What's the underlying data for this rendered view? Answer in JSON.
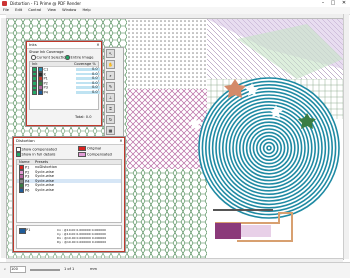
{
  "window": {
    "title": "Distortion - F1 Prime @ PDF Render",
    "minimize": "–",
    "maximize": "□",
    "close": "✕"
  },
  "menu": [
    "File",
    "Edit",
    "Control",
    "View",
    "Window",
    "Help"
  ],
  "ink_panel": {
    "title": "Inks",
    "section_label": "Show Ink Coverage",
    "option_current": "Current Selection",
    "option_entire": "Entire Image",
    "columns": [
      "Ink",
      "Coverage %"
    ],
    "rows": [
      {
        "name": "C1",
        "color": "#2c8fb0",
        "value": "0.0"
      },
      {
        "name": "K",
        "color": "#2b2b2b",
        "value": "0.0"
      },
      {
        "name": "P1",
        "color": "#c0392b",
        "value": "0.0"
      },
      {
        "name": "P2",
        "color": "#3a7d44",
        "value": "0.0"
      },
      {
        "name": "P3",
        "color": "#b768a2",
        "value": "0.0"
      },
      {
        "name": "P4",
        "color": "#1f5c99",
        "value": "0.0"
      }
    ],
    "total_label": "Total:",
    "total_value": "0.0"
  },
  "distortion_panel": {
    "title": "Distortion",
    "show_compensated": "Show compensated",
    "show_full": "Show in full details",
    "legend_original": "Original",
    "legend_compensated": "Compensated",
    "legend_original_color": "#d9231f",
    "legend_compensated_color": "#e39bd6",
    "columns": [
      "Name",
      "Presets"
    ],
    "rows": [
      {
        "name": "P1",
        "color": "#d9231f",
        "preset": "noDistortion"
      },
      {
        "name": "P2",
        "color": "#e39bd6",
        "preset": "Sycle-wise"
      },
      {
        "name": "P3",
        "color": "#b768a2",
        "preset": "Sycle-wise"
      },
      {
        "name": "P4",
        "color": "#8a8a8a",
        "preset": "Sycle-wise"
      },
      {
        "name": "P5",
        "color": "#3a7d44",
        "preset": "Sycle-wise"
      },
      {
        "name": "P6",
        "color": "#1f5c99",
        "preset": "Sycle-wise"
      }
    ],
    "selected_row_name": "P1",
    "detail_lines": [
      "Cx : @10.00   0.000000  0.000000",
      "Cy : @10.00   0.000000  0.000000",
      "Dx : @10.00   0.000000  0.000000",
      "Dy : @10.00   0.000000  0.000000"
    ]
  },
  "status": {
    "zoom": "100",
    "page_label": "1 of 1",
    "units": "mm"
  },
  "colors": {
    "panel_border": "#c0392b",
    "accent": "#2c8fb0",
    "teal": "#1f8aa3"
  }
}
